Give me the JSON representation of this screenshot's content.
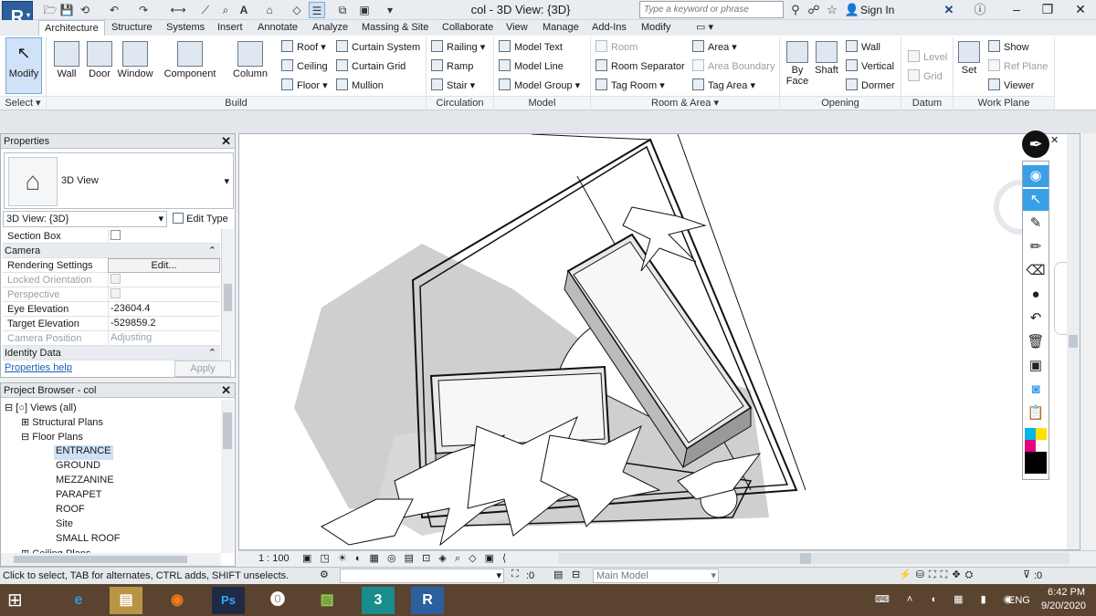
{
  "app": {
    "logo": "R",
    "title": "col - 3D View: {3D}"
  },
  "quick_access": [
    "open-icon",
    "save-icon",
    "sync-icon",
    "undo-icon",
    "redo-icon",
    "measure-icon",
    "dimension-icon",
    "tag-icon",
    "text-icon",
    "3d-view-icon",
    "section-icon",
    "thin-lines-icon",
    "close-hidden-icon",
    "switch-windows-icon"
  ],
  "search": {
    "placeholder": "Type a keyword or phrase"
  },
  "account": {
    "sign_in": "Sign In"
  },
  "tabs": [
    "Architecture",
    "Structure",
    "Systems",
    "Insert",
    "Annotate",
    "Analyze",
    "Massing & Site",
    "Collaborate",
    "View",
    "Manage",
    "Add-Ins",
    "Modify"
  ],
  "ribbon": {
    "select": {
      "modify": "Modify",
      "panel": "Select"
    },
    "build": {
      "panel": "Build",
      "wall": "Wall",
      "door": "Door",
      "window": "Window",
      "component": "Component",
      "column": "Column",
      "roof": "Roof",
      "ceiling": "Ceiling",
      "floor": "Floor",
      "curtain_system": "Curtain System",
      "curtain_grid": "Curtain Grid",
      "mullion": "Mullion"
    },
    "circulation": {
      "panel": "Circulation",
      "railing": "Railing",
      "ramp": "Ramp",
      "stair": "Stair"
    },
    "model": {
      "panel": "Model",
      "model_text": "Model Text",
      "model_line": "Model Line",
      "model_group": "Model Group"
    },
    "room_area": {
      "panel": "Room & Area",
      "room": "Room",
      "room_separator": "Room Separator",
      "tag_room": "Tag Room",
      "area": "Area",
      "area_boundary": "Area Boundary",
      "tag_area": "Tag Area"
    },
    "opening": {
      "panel": "Opening",
      "by_face_1": "By",
      "by_face_2": "Face",
      "shaft": "Shaft",
      "wall": "Wall",
      "vertical": "Vertical",
      "dormer": "Dormer"
    },
    "datum": {
      "panel": "Datum",
      "level": "Level",
      "grid": "Grid"
    },
    "work_plane": {
      "panel": "Work Plane",
      "set": "Set",
      "show": "Show",
      "ref_plane": "Ref Plane",
      "viewer": "Viewer"
    }
  },
  "properties": {
    "title": "Properties",
    "type_name": "3D View",
    "instance": "3D View: {3D}",
    "edit_type": "Edit Type",
    "section_box": "Section Box",
    "camera": "Camera",
    "rendering_settings": "Rendering Settings",
    "edit_btn": "Edit...",
    "locked_orientation": "Locked Orientation",
    "perspective": "Perspective",
    "eye_elevation": "Eye Elevation",
    "eye_elevation_val": "-23604.4",
    "target_elevation": "Target Elevation",
    "target_elevation_val": "-529859.2",
    "camera_position": "Camera Position",
    "camera_position_val": "Adjusting",
    "identity_data": "Identity Data",
    "help": "Properties help",
    "apply": "Apply"
  },
  "browser": {
    "title": "Project Browser - col",
    "views": "Views (all)",
    "structural_plans": "Structural Plans",
    "floor_plans": "Floor Plans",
    "items": [
      "ENTRANCE",
      "GROUND",
      "MEZZANINE",
      "PARAPET",
      "ROOF",
      "Site",
      "SMALL ROOF"
    ],
    "ceiling": "Ceiling Plans"
  },
  "view_bar": {
    "scale": "1 : 100"
  },
  "status": {
    "hint": "Click to select, TAB for alternates, CTRL adds, SHIFT unselects.",
    "sel_count": ":0",
    "workset": "Main Model",
    "filter_count": ":0"
  },
  "taskbar": {
    "apps": [
      "edge-icon",
      "file-explorer-icon",
      "firefox-icon",
      "photoshop-icon",
      "sketchup-icon",
      "camtasia-icon",
      "3dsmax-icon",
      "revit-icon"
    ],
    "lang": "ENG",
    "time": "6:42 PM",
    "date": "9/20/2020"
  },
  "colors": {
    "accent": "#2c5f9e",
    "selection": "#cde0f5",
    "taskbar": "#5a4430"
  }
}
